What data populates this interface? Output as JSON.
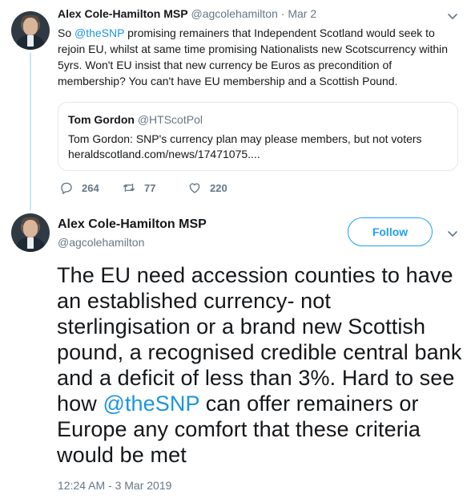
{
  "tweet1": {
    "name": "Alex Cole-Hamilton MSP",
    "handle": "@agcolehamilton",
    "separator": "·",
    "date": "Mar 2",
    "body": {
      "part1": "So ",
      "mention": "@theSNP",
      "part2": " promising remainers that Independent Scotland would seek to rejoin EU, whilst at same time promising Nationalists new Scotscurrency within 5yrs. Won't EU insist that new currency be Euros as precondition of membership? You can't have EU membership and a Scottish Pound."
    },
    "quote": {
      "name": "Tom Gordon",
      "handle": "@HTScotPol",
      "text": "Tom Gordon: SNP's currency plan may please members, but not voters",
      "link": "heraldscotland.com/news/17471075...."
    },
    "actions": {
      "replies": "264",
      "retweets": "77",
      "likes": "220"
    }
  },
  "tweet2": {
    "name": "Alex Cole-Hamilton MSP",
    "handle": "@agcolehamilton",
    "follow_label": "Follow",
    "body": {
      "part1": "The EU need accession counties to have an established currency- not sterlingisation or a brand new Scottish pound, a recognised credible central bank and a deficit of less than 3%. Hard to see how ",
      "mention": "@theSNP",
      "part2": " can offer remainers or Europe any comfort that these criteria would be met"
    },
    "timestamp": "12:24 AM - 3 Mar 2019"
  },
  "colors": {
    "link": "#1b95e0",
    "follow": "#1da1f2",
    "muted": "#657786",
    "thread_line": "#cce4f5"
  },
  "icons": [
    "reply-icon",
    "retweet-icon",
    "like-icon",
    "chevron-down-icon"
  ]
}
